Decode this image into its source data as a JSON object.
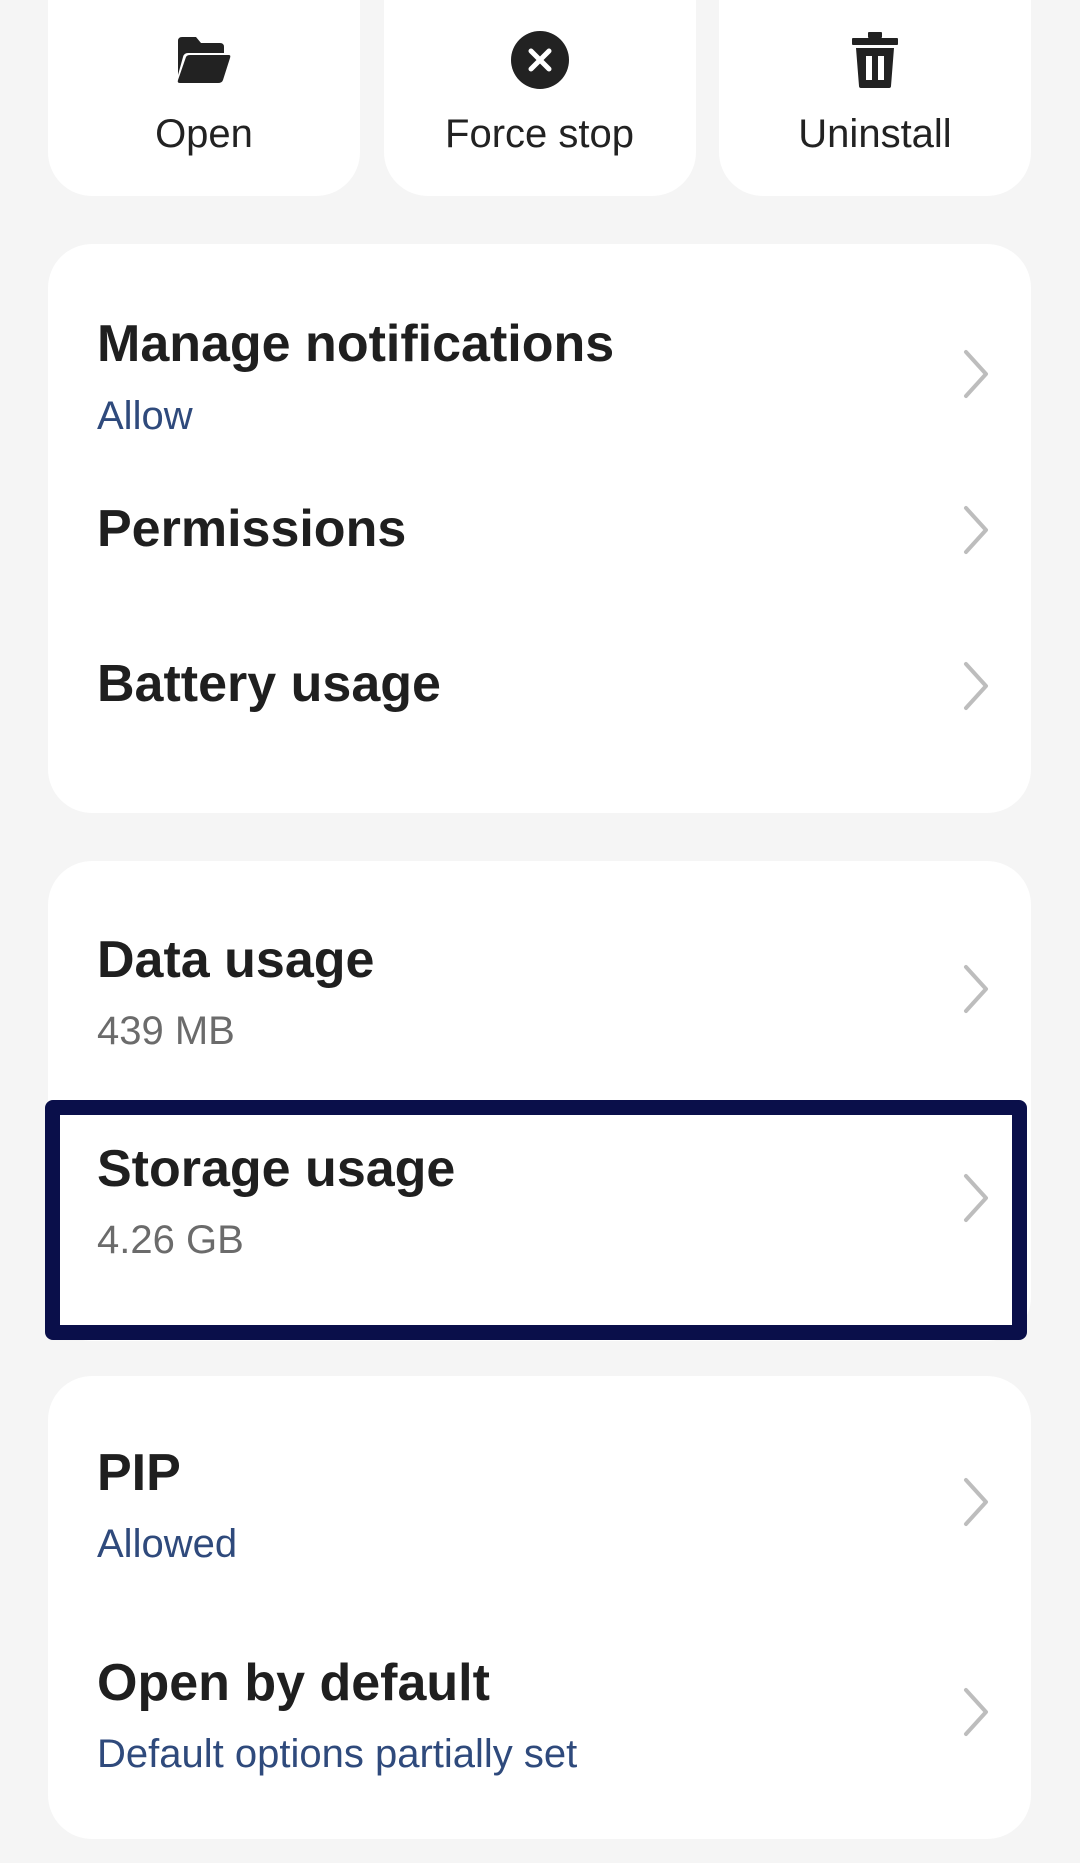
{
  "actions": {
    "open": {
      "label": "Open",
      "icon": "folder-open-icon"
    },
    "force_stop": {
      "label": "Force stop",
      "icon": "close-circle-icon"
    },
    "uninstall": {
      "label": "Uninstall",
      "icon": "trash-icon"
    }
  },
  "card1": {
    "manage_notifications": {
      "title": "Manage notifications",
      "subtitle": "Allow"
    },
    "permissions": {
      "title": "Permissions"
    },
    "battery_usage": {
      "title": "Battery usage"
    }
  },
  "card2": {
    "data_usage": {
      "title": "Data usage",
      "subtitle": "439 MB"
    },
    "storage_usage": {
      "title": "Storage usage",
      "subtitle": "4.26 GB",
      "highlighted": true
    }
  },
  "card3": {
    "pip": {
      "title": "PIP",
      "subtitle": "Allowed"
    },
    "open_by_default": {
      "title": "Open by default",
      "subtitle": "Default options partially set"
    }
  },
  "colors": {
    "background": "#f5f5f5",
    "card": "#ffffff",
    "title": "#1f1f1f",
    "accent_subtitle": "#2f4a7c",
    "gray_subtitle": "#6b6b6b",
    "highlight_border": "#0a0f4a",
    "chevron": "#bdbdbd"
  }
}
